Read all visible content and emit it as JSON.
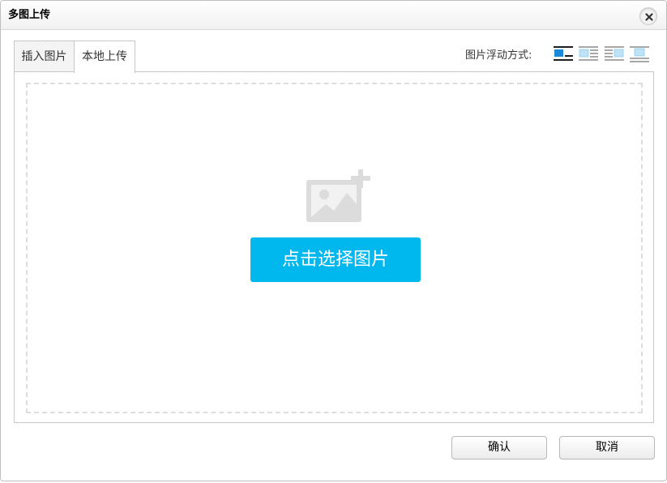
{
  "dialog": {
    "title": "多图上传",
    "close_icon": "close-icon"
  },
  "tabs": [
    {
      "label": "插入图片",
      "active": false
    },
    {
      "label": "本地上传",
      "active": true
    }
  ],
  "float": {
    "label": "图片浮动方式:",
    "options": [
      "none",
      "left",
      "right",
      "center"
    ],
    "selected": "none"
  },
  "upload": {
    "icon": "add-image-icon",
    "button_label": "点击选择图片"
  },
  "footer": {
    "confirm_label": "确认",
    "cancel_label": "取消"
  },
  "colors": {
    "accent": "#00b7ee",
    "selected_icon": "#1a8ad8",
    "image_placeholder": "#dcdcdc"
  }
}
